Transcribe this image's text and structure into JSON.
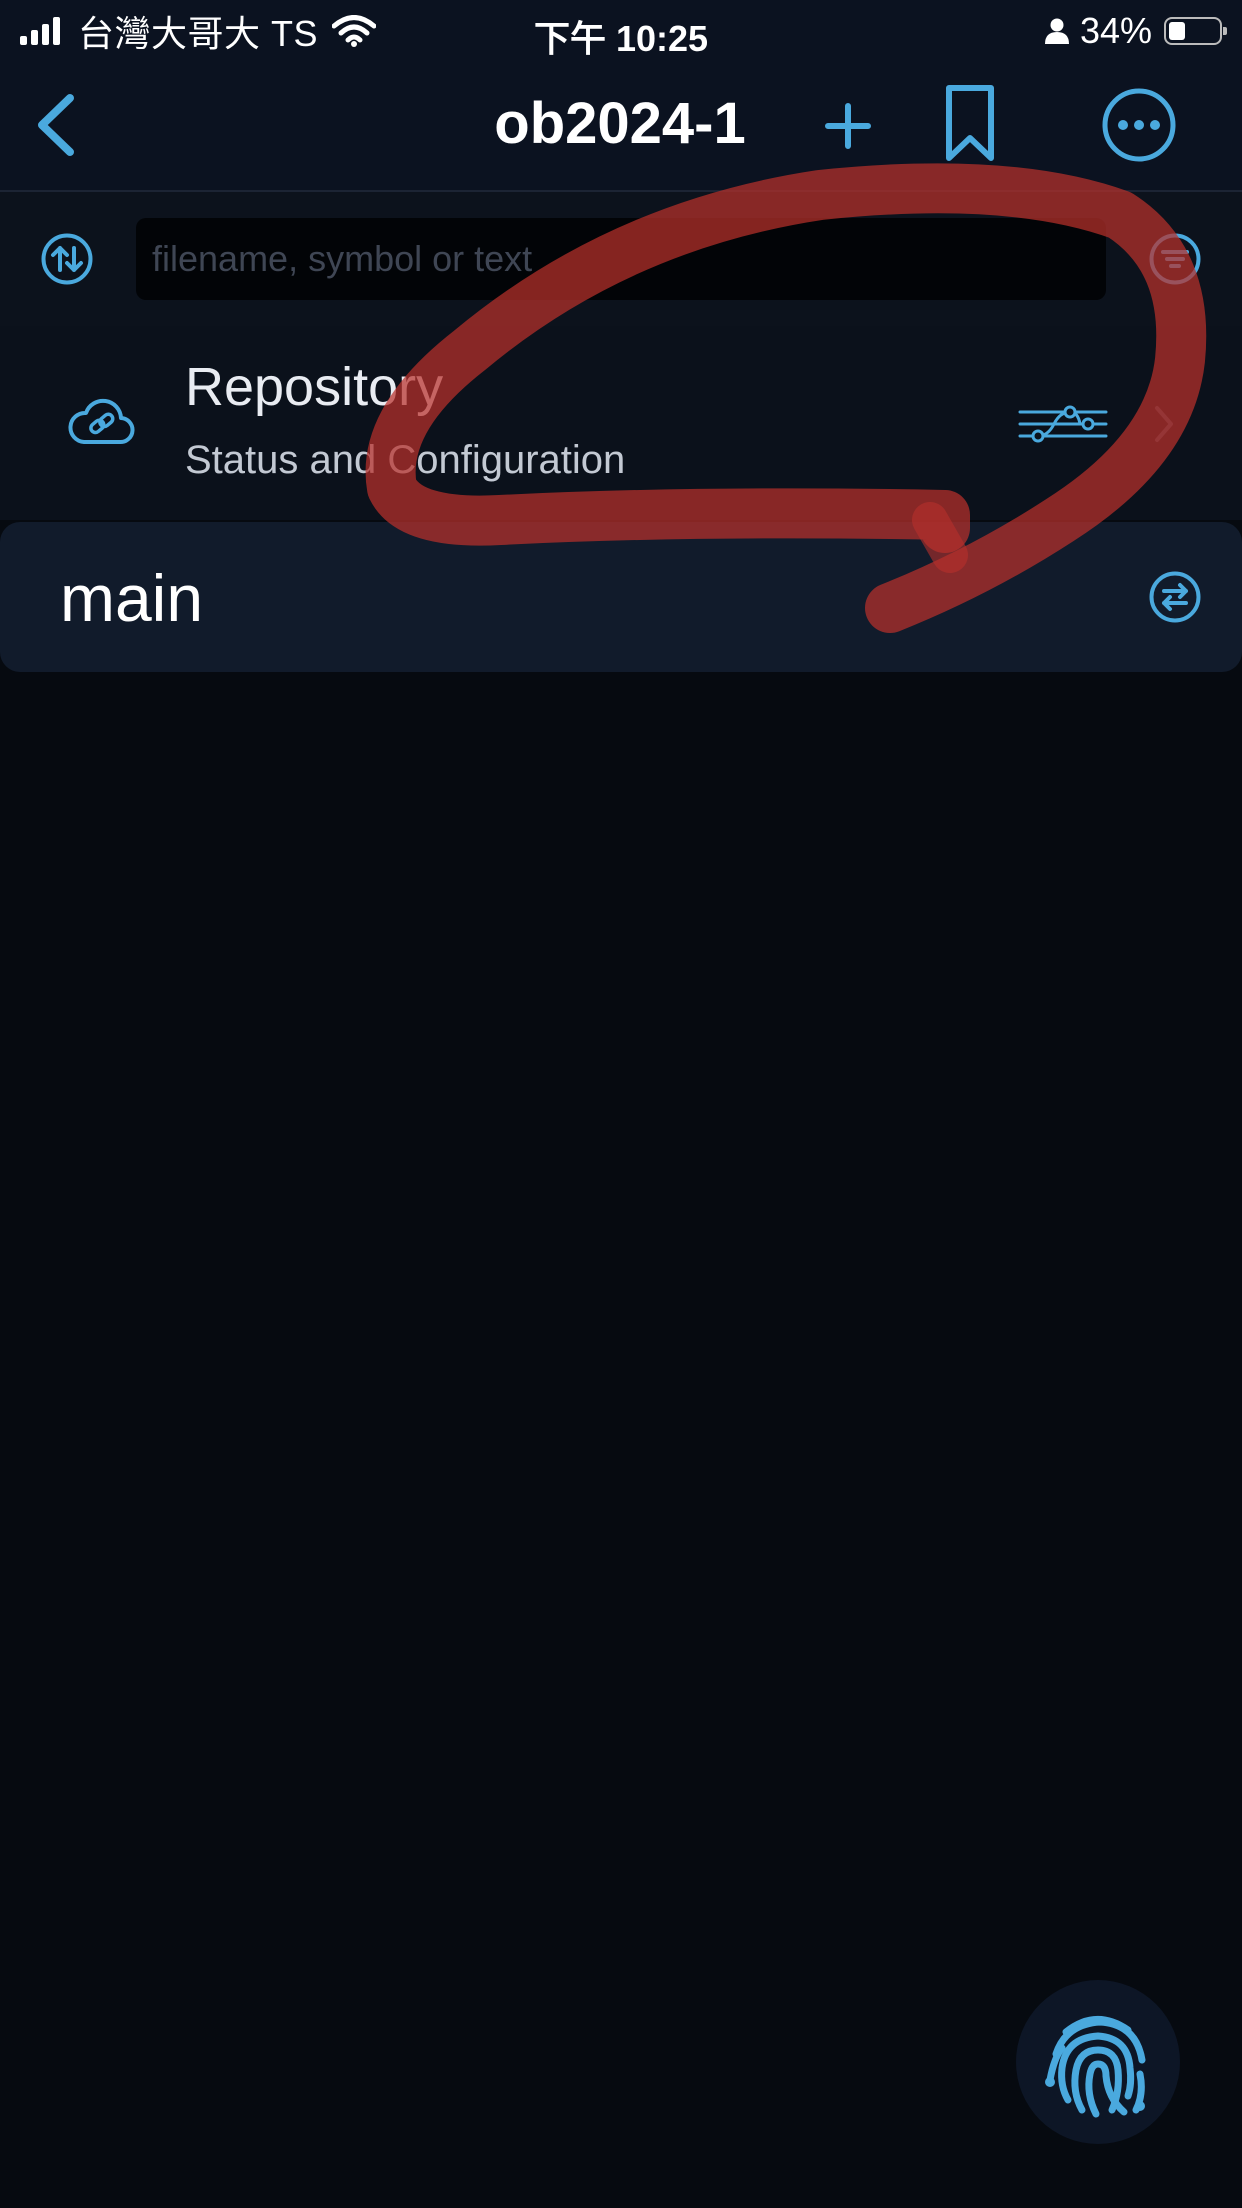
{
  "status_bar": {
    "carrier": "台灣大哥大 TS",
    "time": "下午 10:25",
    "battery": "34%",
    "battery_level": 0.34
  },
  "nav": {
    "title": "ob2024-1",
    "icons": [
      "back-chevron-icon",
      "plus-icon",
      "bookmark-icon",
      "more-icon"
    ]
  },
  "search": {
    "placeholder": "filename, symbol or text",
    "value": ""
  },
  "repository": {
    "title": "Repository",
    "subtitle": "Status and Configuration"
  },
  "branch": {
    "name": "main"
  },
  "colors": {
    "accent": "#4aa9de",
    "background": "#060a10",
    "annotation": "#b8302b"
  }
}
